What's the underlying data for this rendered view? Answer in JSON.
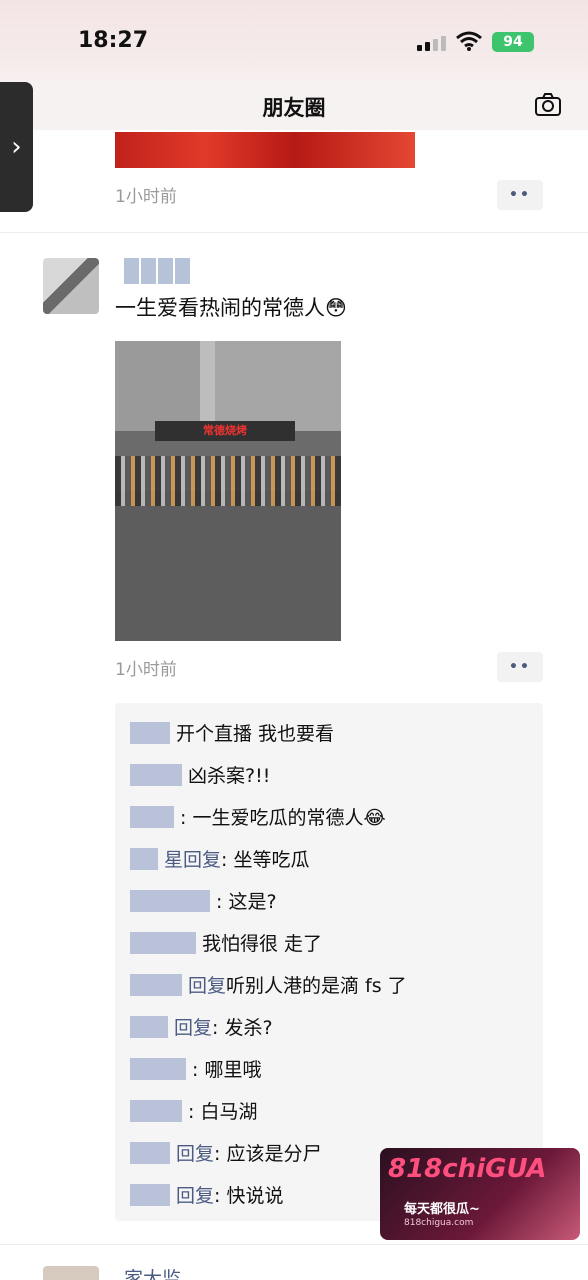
{
  "status_bar": {
    "time": "18:27",
    "battery": "94"
  },
  "nav": {
    "title": "朋友圈",
    "side_tab_glyph": "›"
  },
  "prev_post": {
    "timestamp": "1小时前",
    "more": "••"
  },
  "post": {
    "text": "一生爱看热闹的常德人😳",
    "photo_sign": "常德烧烤",
    "timestamp": "1小时前",
    "more": "••"
  },
  "comments": [
    {
      "name_w": 40,
      "label": "",
      "text": "开个直播 我也要看"
    },
    {
      "name_w": 52,
      "label": "",
      "text": "凶杀案?!!"
    },
    {
      "name_w": 44,
      "label": "",
      "text": ": 一生爱吃瓜的常德人😂"
    },
    {
      "name_w": 28,
      "label": "星回复",
      "text": ": 坐等吃瓜"
    },
    {
      "name_w": 80,
      "label": "",
      "text": ": 这是?"
    },
    {
      "name_w": 66,
      "label": "",
      "text": "我怕得很 走了"
    },
    {
      "name_w": 52,
      "label": "回复",
      "text": "听别人港的是滴 fs 了"
    },
    {
      "name_w": 38,
      "label": "回复",
      "text": ": 发杀?"
    },
    {
      "name_w": 56,
      "label": "",
      "text": ": 哪里哦"
    },
    {
      "name_w": 52,
      "label": "",
      "text": ": 白马湖"
    },
    {
      "name_w": 40,
      "label": "回复",
      "text": ": 应该是分尸"
    },
    {
      "name_w": 40,
      "label": "回复",
      "text": ": 快说说"
    }
  ],
  "watermark": {
    "logo": "818chiGUA",
    "slogan": "每天都很瓜~",
    "url": "818chigua.com"
  },
  "next_post": {
    "name": "家大监"
  },
  "colors": {
    "accent_link": "#4b5b82",
    "battery": "#3ec46d",
    "timestamp": "#9a9a9a"
  }
}
